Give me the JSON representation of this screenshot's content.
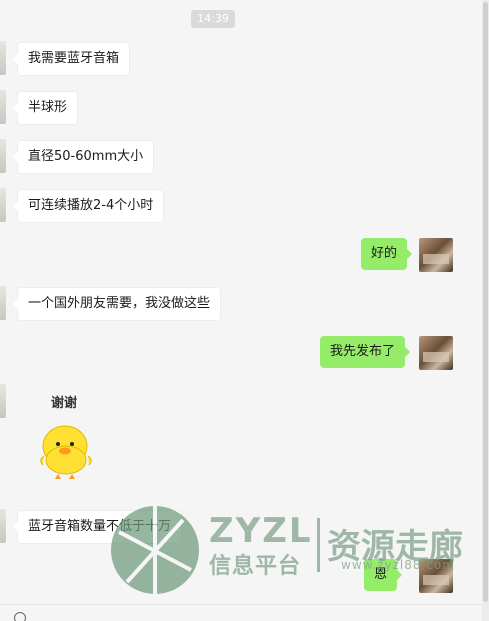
{
  "timestamp": "14:39",
  "messages": [
    {
      "side": "left",
      "text": "我需要蓝牙音箱"
    },
    {
      "side": "left",
      "text": "半球形"
    },
    {
      "side": "left",
      "text": "直径50-60mm大小"
    },
    {
      "side": "left",
      "text": "可连续播放2-4个小时"
    },
    {
      "side": "right",
      "text": "好的"
    },
    {
      "side": "left",
      "text": "一个国外朋友需要，我没做这些"
    },
    {
      "side": "right",
      "text": "我先发布了"
    },
    {
      "side": "left",
      "sticker_caption": "谢谢",
      "sticker": "yellow-duck-sticker"
    },
    {
      "side": "left",
      "text": "蓝牙音箱数量不低于十万"
    },
    {
      "side": "right",
      "text": "恩"
    }
  ],
  "watermark": {
    "brand": "ZYZL",
    "subtitle": "信息平台",
    "chinese": "资源走廊",
    "url": "www.zyzl88.com"
  },
  "colors": {
    "bubble_right": "#95ec69",
    "bubble_left": "#ffffff",
    "background": "#f5f5f5",
    "watermark": "#7da08a"
  }
}
